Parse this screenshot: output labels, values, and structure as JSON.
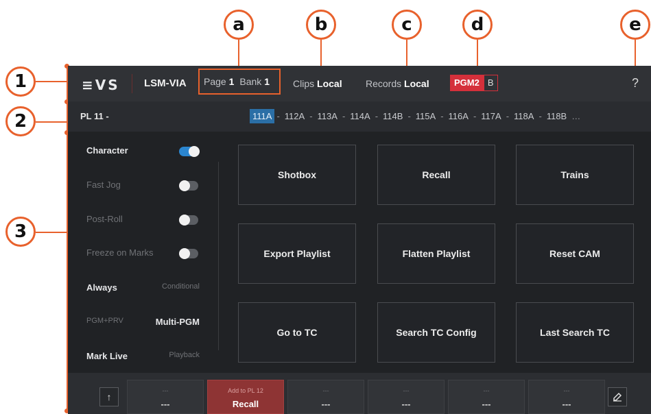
{
  "callouts": {
    "n1": "1",
    "n2": "2",
    "n3": "3",
    "a": "a",
    "b": "b",
    "c": "c",
    "d": "d",
    "e": "e"
  },
  "topbar": {
    "logo": "≡VS",
    "app_name": "LSM-VIA",
    "page_label": "Page",
    "page_value": "1",
    "bank_label": "Bank",
    "bank_value": "1",
    "clips_label": "Clips",
    "clips_value": "Local",
    "records_label": "Records",
    "records_value": "Local",
    "pgm_primary": "PGM2",
    "pgm_secondary": "B",
    "help": "?"
  },
  "playlist_bar": {
    "name": "PL 11 -",
    "clips": [
      "111A",
      "112A",
      "113A",
      "114A",
      "114B",
      "115A",
      "116A",
      "117A",
      "118A",
      "118B"
    ],
    "separator": "-",
    "overflow": "…"
  },
  "left_panel": {
    "toggles": [
      {
        "label": "Character",
        "state": "on"
      },
      {
        "label": "Fast Jog",
        "state": "off"
      },
      {
        "label": "Post-Roll",
        "state": "off"
      },
      {
        "label": "Freeze on Marks",
        "state": "off"
      }
    ],
    "pairs": [
      {
        "left": "Always",
        "right": "Conditional",
        "selected": "left"
      },
      {
        "left": "PGM+PRV",
        "right": "Multi-PGM",
        "selected": "right"
      },
      {
        "left": "Mark Live",
        "right": "Playback",
        "selected": "left"
      }
    ]
  },
  "grid": {
    "tiles": [
      "Shotbox",
      "Recall",
      "Trains",
      "Export Playlist",
      "Flatten Playlist",
      "Reset CAM",
      "Go to TC",
      "Search TC Config",
      "Last Search TC"
    ]
  },
  "bottom_bar": {
    "up_icon": "up-arrow-icon",
    "edit_icon": "edit-icon",
    "keys": [
      {
        "top": "---",
        "bottom": "---"
      },
      {
        "top": "Add to PL 12",
        "bottom": "Recall",
        "highlight": true
      },
      {
        "top": "---",
        "bottom": "---"
      },
      {
        "top": "---",
        "bottom": "---"
      },
      {
        "top": "---",
        "bottom": "---"
      },
      {
        "top": "---",
        "bottom": "---"
      }
    ]
  },
  "colors": {
    "accent": "#e8612c",
    "pgm_red": "#d5303b",
    "active_blue": "#2b6fa6",
    "toggle_on": "#2b86d0",
    "recall_red": "#8e3434"
  }
}
